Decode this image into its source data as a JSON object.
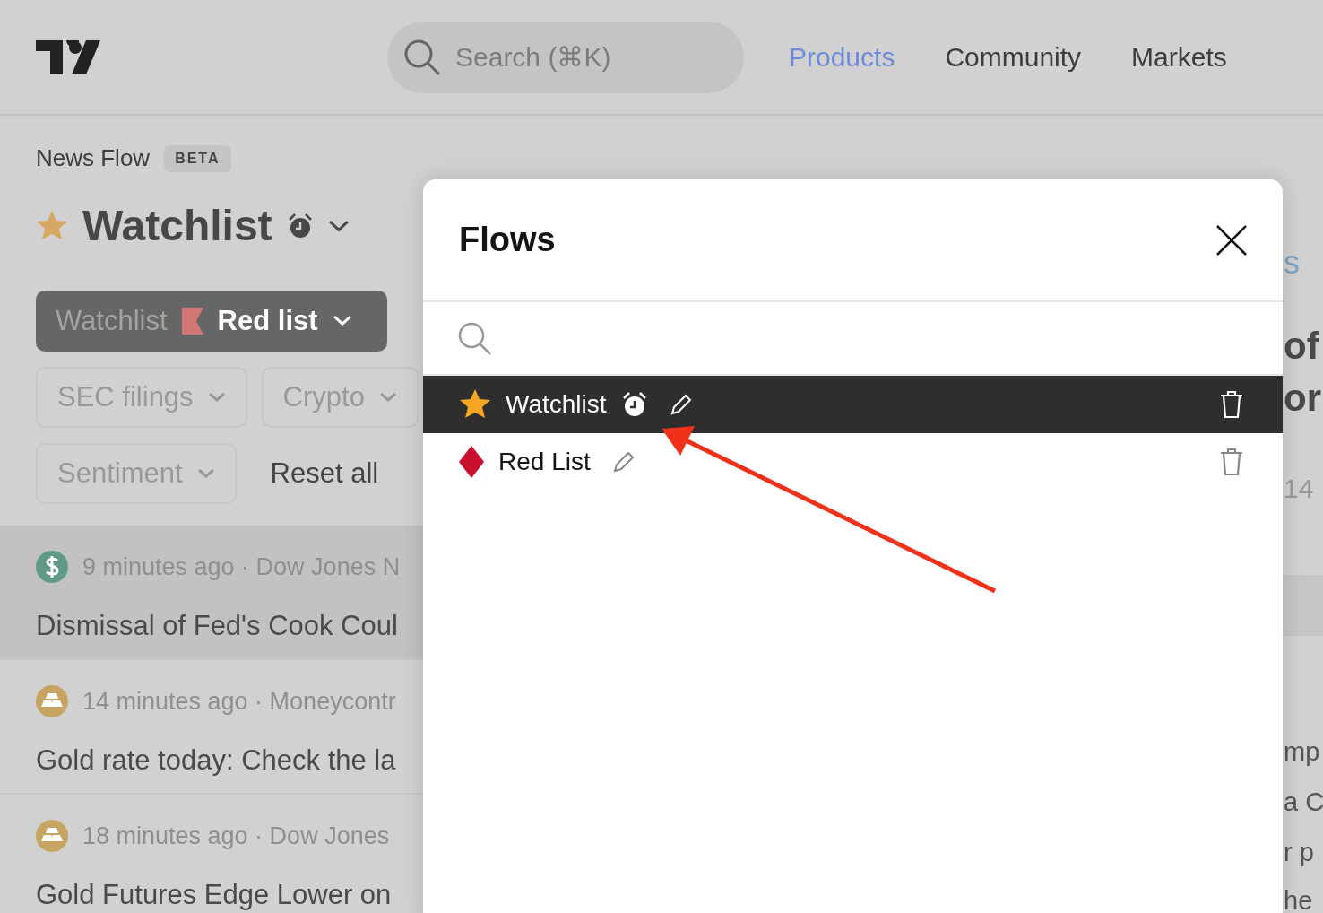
{
  "header": {
    "search": {
      "placeholder": "Search (⌘K)"
    },
    "nav": [
      {
        "label": "Products",
        "selected": true
      },
      {
        "label": "Community",
        "selected": false
      },
      {
        "label": "Markets",
        "selected": false
      }
    ]
  },
  "page": {
    "section": "News Flow",
    "badge": "BETA",
    "title": "Watchlist",
    "alert": true,
    "filters": [
      {
        "kind": "flow",
        "label": "Watchlist",
        "value": "Red list"
      },
      {
        "kind": "dropdown",
        "label": "SEC filings"
      },
      {
        "kind": "dropdown",
        "label": "Crypto"
      },
      {
        "kind": "dropdown",
        "label": "Sentiment"
      },
      {
        "kind": "reset",
        "label": "Reset all"
      }
    ],
    "news": [
      {
        "kind": "dollar",
        "meta": "9 minutes ago · Dow Jones N",
        "headline": "Dismissal of Fed's Cook Coul",
        "selected": true
      },
      {
        "kind": "bars",
        "meta": "14 minutes ago · Moneycontr",
        "headline": "Gold rate today: Check the la",
        "selected": false
      },
      {
        "kind": "bars",
        "meta": "18 minutes ago · Dow Jones",
        "headline": "Gold Futures Edge Lower on",
        "selected": false
      }
    ]
  },
  "right_column": [
    {
      "kind": "link",
      "text": "s"
    },
    {
      "kind": "title",
      "text": "of"
    },
    {
      "kind": "title",
      "text": "or"
    },
    {
      "kind": "meta",
      "text": "14"
    },
    {
      "kind": "pill"
    },
    {
      "kind": "body",
      "text": "mp"
    },
    {
      "kind": "body",
      "text": "a C"
    },
    {
      "kind": "body",
      "text": "r p"
    },
    {
      "kind": "body",
      "text": "he"
    }
  ],
  "dialog": {
    "title": "Flows",
    "flows": [
      {
        "name": "Watchlist",
        "kind": "star",
        "alert": true,
        "selected": true
      },
      {
        "name": "Red List",
        "kind": "diamond",
        "alert": false,
        "selected": false
      }
    ]
  }
}
